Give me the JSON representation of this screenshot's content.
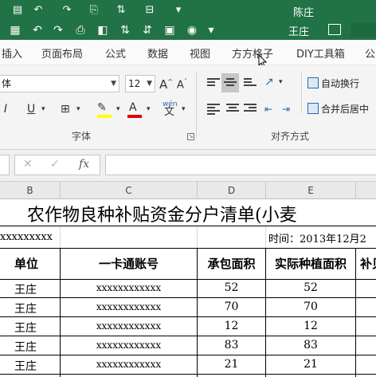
{
  "window": {
    "user_name": "陈庄",
    "doc_user": "王庄"
  },
  "ribbon_tabs": [
    {
      "label": "插入"
    },
    {
      "label": "页面布局"
    },
    {
      "label": "公式"
    },
    {
      "label": "数据"
    },
    {
      "label": "视图"
    },
    {
      "label": "方方格子"
    },
    {
      "label": "DIY工具箱"
    },
    {
      "label": "公"
    }
  ],
  "font_group": {
    "font_name": "体",
    "font_size": "12",
    "label": "字体",
    "wen_label": "wén"
  },
  "align_group": {
    "wrap_text_label": "自动换行",
    "merge_center_label": "合并后居中",
    "label": "对齐方式"
  },
  "formula_bar": {
    "function_symbol": "fx",
    "value": ""
  },
  "columns": [
    "B",
    "C",
    "D",
    "E"
  ],
  "sheet": {
    "title": "农作物良种补贴资金分户清单(小麦",
    "subheader_left": "xxxxxxxxx",
    "subheader_time": "时间：2013年12月2",
    "headers": [
      "单位",
      "一卡通账号",
      "承包面积",
      "实际种植面积",
      "补贝"
    ],
    "rows": [
      {
        "unit": "王庄",
        "account": "xxxxxxxxxxxx",
        "contract_area": "52",
        "actual_area": "52"
      },
      {
        "unit": "王庄",
        "account": "xxxxxxxxxxxx",
        "contract_area": "70",
        "actual_area": "70"
      },
      {
        "unit": "王庄",
        "account": "xxxxxxxxxxxx",
        "contract_area": "12",
        "actual_area": "12"
      },
      {
        "unit": "王庄",
        "account": "xxxxxxxxxxxx",
        "contract_area": "83",
        "actual_area": "83"
      },
      {
        "unit": "王庄",
        "account": "xxxxxxxxxxxx",
        "contract_area": "21",
        "actual_area": "21"
      }
    ]
  }
}
